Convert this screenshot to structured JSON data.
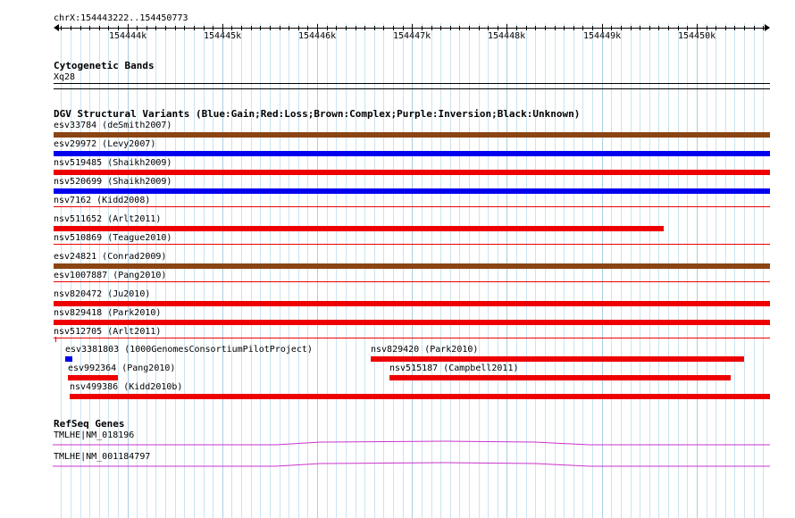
{
  "ruler": {
    "range": "chrX:154443222..154450773",
    "ticks": [
      {
        "label": "154444k",
        "pos": 154444000
      },
      {
        "label": "154445k",
        "pos": 154445000
      },
      {
        "label": "154446k",
        "pos": 154446000
      },
      {
        "label": "154447k",
        "pos": 154447000
      },
      {
        "label": "154448k",
        "pos": 154448000
      },
      {
        "label": "154449k",
        "pos": 154449000
      },
      {
        "label": "154450k",
        "pos": 154450000
      }
    ]
  },
  "cyto": {
    "title": "Cytogenetic Bands",
    "band": "Xq28"
  },
  "dgv": {
    "title": "DGV Structural Variants (Blue:Gain;Red:Loss;Brown:Complex;Purple:Inversion;Black:Unknown)",
    "colors": {
      "gain": "#0000ee",
      "loss": "#ee0000",
      "complex": "#8b4513",
      "thin_loss": "#ee0000"
    },
    "rows": [
      {
        "label": "esv33784 (deSmith2007)",
        "type": "complex",
        "start": 154443222,
        "end": 154450773
      },
      {
        "label": "esv29972 (Levy2007)",
        "type": "gain",
        "start": 154443222,
        "end": 154450773
      },
      {
        "label": "nsv519485 (Shaikh2009)",
        "type": "loss",
        "start": 154443222,
        "end": 154450773
      },
      {
        "label": "nsv520699 (Shaikh2009)",
        "type": "gain",
        "start": 154443222,
        "end": 154450773
      },
      {
        "label": "nsv7162 (Kidd2008)",
        "type": "thin_loss",
        "start": 154443222,
        "end": 154450773
      },
      {
        "label": "nsv511652 (Arlt2011)",
        "type": "loss",
        "start": 154443222,
        "end": 154449650
      },
      {
        "label": "nsv510869 (Teague2010)",
        "type": "thin_loss",
        "start": 154443222,
        "end": 154450773
      },
      {
        "label": "esv24821 (Conrad2009)",
        "type": "complex",
        "start": 154443222,
        "end": 154450773
      },
      {
        "label": "esv1007887 (Pang2010)",
        "type": "thin_loss",
        "start": 154443222,
        "end": 154450773
      },
      {
        "label": "nsv820472 (Ju2010)",
        "type": "loss",
        "start": 154443222,
        "end": 154450773
      },
      {
        "label": "nsv829418 (Park2010)",
        "type": "loss",
        "start": 154443222,
        "end": 154450773
      },
      {
        "label": "nsv512705 (Arlt2011)",
        "type": "thin_loss",
        "start": 154443222,
        "end": 154450773
      }
    ],
    "packed": [
      {
        "label": "esv3381803 (1000GenomesConsortiumPilotProject)",
        "type": "gain",
        "start": 154443340,
        "end": 154443420,
        "row": 0
      },
      {
        "label": "nsv829420 (Park2010)",
        "type": "loss",
        "start": 154446560,
        "end": 154450500,
        "row": 0
      },
      {
        "label": "esv992364 (Pang2010)",
        "type": "loss",
        "start": 154443370,
        "end": 154443900,
        "row": 1
      },
      {
        "label": "nsv515187 (Campbell2011)",
        "type": "loss",
        "start": 154446760,
        "end": 154450360,
        "row": 1
      },
      {
        "label": "nsv499386 (Kidd2010b)",
        "type": "loss",
        "start": 154443390,
        "end": 154450773,
        "row": 2
      }
    ]
  },
  "refseq": {
    "title": "RefSeq Genes",
    "color": "#cc33cc",
    "genes": [
      {
        "label": "TMLHE|NM_018196"
      },
      {
        "label": "TMLHE|NM_001184797"
      }
    ]
  }
}
